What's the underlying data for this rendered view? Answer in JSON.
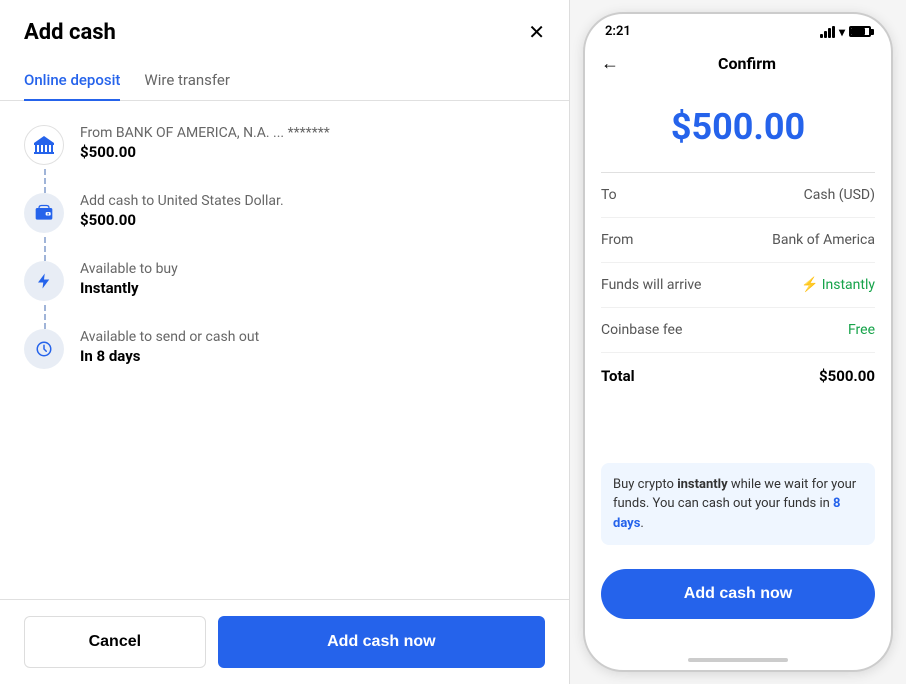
{
  "left": {
    "title": "Add cash",
    "tabs": [
      {
        "label": "Online deposit",
        "active": true
      },
      {
        "label": "Wire transfer",
        "active": false
      }
    ],
    "steps": [
      {
        "icon": "bank",
        "label": "From BANK OF AMERICA, N.A. ... *******",
        "value": "$500.00"
      },
      {
        "icon": "wallet",
        "label": "Add cash to United States Dollar.",
        "value": "$500.00"
      },
      {
        "icon": "lightning",
        "label": "Available to buy",
        "value": "Instantly"
      },
      {
        "icon": "clock",
        "label": "Available to send or cash out",
        "value": "In 8 days"
      }
    ],
    "footer": {
      "cancel": "Cancel",
      "confirm": "Add cash now"
    }
  },
  "right": {
    "status_time": "2:21",
    "nav_title": "Confirm",
    "amount": "$500.00",
    "details": [
      {
        "label": "To",
        "value": "Cash (USD)",
        "type": "normal"
      },
      {
        "label": "From",
        "value": "Bank of America",
        "type": "normal"
      },
      {
        "label": "Funds will arrive",
        "value": "⚡ Instantly",
        "type": "green"
      },
      {
        "label": "Coinbase fee",
        "value": "Free",
        "type": "green-text"
      },
      {
        "label": "Total",
        "value": "$500.00",
        "type": "total"
      }
    ],
    "info_text_prefix": "Buy crypto ",
    "info_bold1": "instantly",
    "info_text_mid": " while we wait for your funds. You can cash out your funds in ",
    "info_bold2": "8 days",
    "info_text_end": ".",
    "add_btn": "Add cash now"
  }
}
